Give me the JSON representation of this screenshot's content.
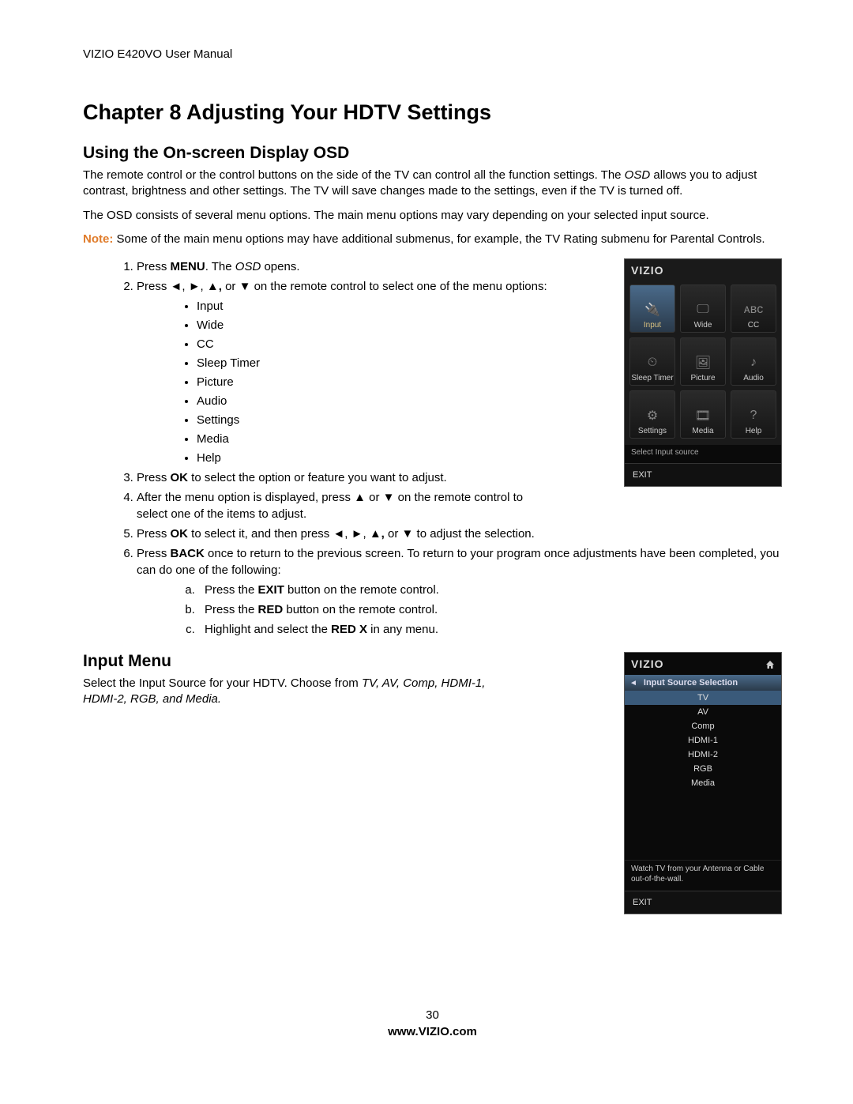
{
  "header": "VIZIO E420VO User Manual",
  "chapter_title": "Chapter 8 Adjusting Your HDTV Settings",
  "section1_title": "Using the On-screen Display OSD",
  "para1a": "The remote control or the control buttons on the side of the TV can control all the function settings. The ",
  "para1b_italic": "OSD",
  "para1c": " allows you to adjust contrast, brightness and other settings. The TV will save changes made to the settings, even if the TV is turned off.",
  "para2": "The OSD consists of several menu options. The main menu options may vary depending on your selected input source.",
  "note_label": "Note:",
  "note_text": "  Some of the main menu options may have additional submenus, for example, the TV Rating submenu for Parental Controls.",
  "step1_a": "Press ",
  "step1_b": "MENU",
  "step1_c": ". The ",
  "step1_d": "OSD",
  "step1_e": " opens.",
  "step2_a": "Press ◄, ►, ▲",
  "step2_b": ", ",
  "step2_c": "or ▼ on the remote control to select one of the menu options:",
  "menu_options": [
    "Input",
    "Wide",
    "CC",
    "Sleep Timer",
    "Picture",
    "Audio",
    "Settings",
    "Media",
    "Help"
  ],
  "step3_a": "Press ",
  "step3_b": "OK",
  "step3_c": " to select the option or feature you want to adjust.",
  "step4": "After the menu option is displayed, press ▲ or ▼ on the remote control to select one of the items to adjust.",
  "step5_a": "Press ",
  "step5_b": "OK",
  "step5_c": " to select it, and then press ◄, ►, ▲",
  "step5_d": ", ",
  "step5_e": "or ▼ to adjust the selection.",
  "step6_a": "Press ",
  "step6_b": "BACK",
  "step6_c": " once to return to the previous screen. To return to your program once adjustments have been completed, you can do one of the following:",
  "sub_a_1": "Press the ",
  "sub_a_2": "EXIT",
  "sub_a_3": " button on the remote control.",
  "sub_b_1": "Press the ",
  "sub_b_2": "RED",
  "sub_b_3": " button on the remote control.",
  "sub_c_1": "Highlight and select the ",
  "sub_c_2": "RED X",
  "sub_c_3": " in any menu.",
  "section2_title": "Input Menu",
  "input_para_a": "Select the Input Source for your HDTV. Choose from ",
  "input_para_b": "TV, AV, Comp, HDMI-1, HDMI-2, RGB, and Media.",
  "osd1": {
    "brand": "VIZIO",
    "tiles": [
      {
        "label": "Input",
        "icon": "plug-icon",
        "selected": true
      },
      {
        "label": "Wide",
        "icon": "monitor-icon",
        "selected": false
      },
      {
        "label": "CC",
        "icon": "cc-icon",
        "selected": false
      },
      {
        "label": "Sleep Timer",
        "icon": "clock-icon",
        "selected": false
      },
      {
        "label": "Picture",
        "icon": "picture-icon",
        "selected": false
      },
      {
        "label": "Audio",
        "icon": "audio-icon",
        "selected": false
      },
      {
        "label": "Settings",
        "icon": "gear-icon",
        "selected": false
      },
      {
        "label": "Media",
        "icon": "media-icon",
        "selected": false
      },
      {
        "label": "Help",
        "icon": "help-icon",
        "selected": false
      }
    ],
    "status": "Select Input source",
    "exit": "EXIT"
  },
  "osd2": {
    "brand": "VIZIO",
    "title": "Input Source Selection",
    "items": [
      {
        "label": "TV",
        "selected": true
      },
      {
        "label": "AV",
        "selected": false
      },
      {
        "label": "Comp",
        "selected": false
      },
      {
        "label": "HDMI-1",
        "selected": false
      },
      {
        "label": "HDMI-2",
        "selected": false
      },
      {
        "label": "RGB",
        "selected": false
      },
      {
        "label": "Media",
        "selected": false
      }
    ],
    "hint": "Watch TV from your Antenna or Cable out-of-the-wall.",
    "exit": "EXIT"
  },
  "page_number": "30",
  "footer_url": "www.VIZIO.com"
}
